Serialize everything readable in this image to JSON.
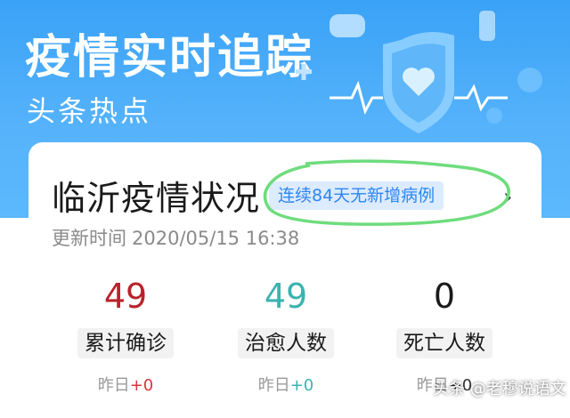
{
  "banner": {
    "title": "疫情实时追踪",
    "subtitle": "头条热点"
  },
  "card": {
    "title": "临沂疫情状况",
    "tag": "连续84天无新增病例",
    "update_label": "更新时间",
    "update_time": "2020/05/15 16:38"
  },
  "stats": [
    {
      "value": "49",
      "label": "累计确诊",
      "yday_label": "昨日",
      "yday_delta": "+0",
      "color": "#b8232b",
      "delta_color": "#d9363e"
    },
    {
      "value": "49",
      "label": "治愈人数",
      "yday_label": "昨日",
      "yday_delta": "+0",
      "color": "#3bb3b0",
      "delta_color": "#3bb3b0"
    },
    {
      "value": "0",
      "label": "死亡人数",
      "yday_label": "昨日",
      "yday_delta": "+0",
      "color": "#1a1a1a",
      "delta_color": "#333333"
    }
  ],
  "watermark": "头条 @老穆说语文",
  "colors": {
    "banner": "#3aa2f6",
    "tag_text": "#2f86f3",
    "tag_bg": "#dcebfd",
    "highlight_circle": "#6fdc7d"
  }
}
